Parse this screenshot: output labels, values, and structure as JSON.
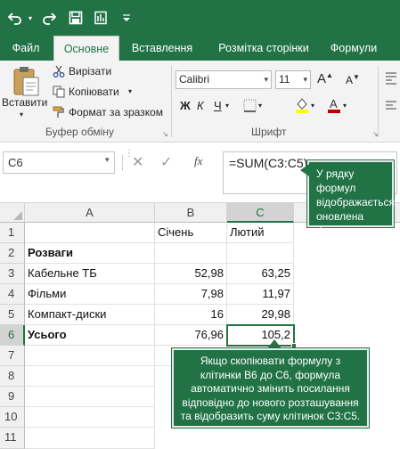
{
  "qat": {
    "undo_icon": "undo-icon",
    "redo_icon": "redo-icon",
    "save_icon": "save-icon",
    "customize_icon": "customize-qat-icon"
  },
  "tabs": [
    {
      "label": "Файл"
    },
    {
      "label": "Основне"
    },
    {
      "label": "Вставлення"
    },
    {
      "label": "Розмітка сторінки"
    },
    {
      "label": "Формули"
    }
  ],
  "ribbon": {
    "paste_label": "Вставити",
    "cut_label": "Вирізати",
    "copy_label": "Копіювати",
    "format_painter_label": "Формат за зразком",
    "clipboard_group": "Буфер обміну",
    "font_name": "Calibri",
    "font_size": "11",
    "bold": "Ж",
    "italic": "К",
    "underline": "Ч",
    "font_group": "Шрифт",
    "highlight_color": "#ffff00",
    "font_color": "#c00000"
  },
  "formula_bar": {
    "name_box": "C6",
    "fx": "fx",
    "formula": "=SUM(C3:C5)"
  },
  "callouts": {
    "formula_bar_note": "У рядку формул відображається оновлена формула.",
    "copy_note": "Якщо скопіювати формулу з клітинки B6 до C6, формула автоматично змінить посилання відповідно до нового розташування та відобразить суму клітинок C3:C5."
  },
  "sheet": {
    "columns": [
      "A",
      "B",
      "C"
    ],
    "rows": [
      "1",
      "2",
      "3",
      "4",
      "5",
      "6",
      "7",
      "8",
      "9",
      "10",
      "11"
    ],
    "cells": {
      "B1": "Січень",
      "C1": "Лютий",
      "A2": "Розваги",
      "A3": "Кабельне ТБ",
      "B3": "52,98",
      "C3": "63,25",
      "A4": "Фільми",
      "B4": "7,98",
      "C4": "11,97",
      "A5": "Компакт-диски",
      "B5": "16",
      "C5": "29,98",
      "A6": "Усього",
      "B6": "76,96",
      "C6": "105,2"
    }
  },
  "colors": {
    "accent": "#217346",
    "ribbon_bg": "#f3f3f3"
  }
}
